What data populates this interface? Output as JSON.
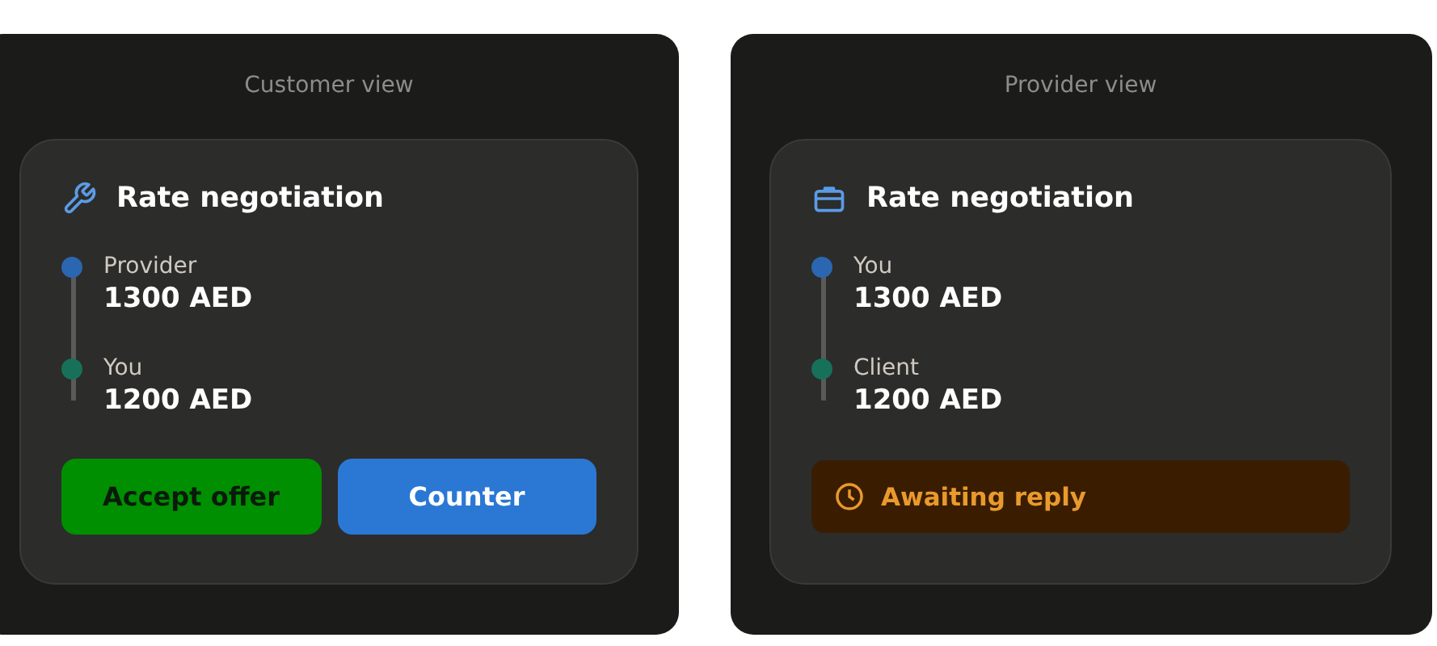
{
  "panels": [
    {
      "title": "Customer view",
      "card": {
        "heading": "Rate negotiation",
        "offers": [
          {
            "party": "Provider",
            "amount": "1300 AED",
            "color": "#2a67b0"
          },
          {
            "party": "You",
            "amount": "1200 AED",
            "color": "#17705a"
          }
        ],
        "footer": {
          "kind": "actions",
          "buttons": [
            {
              "label": "Accept offer",
              "color": "#008f00"
            },
            {
              "label": "Counter",
              "color": "#2b78d4"
            }
          ]
        }
      }
    },
    {
      "title": "Provider view",
      "card": {
        "heading": "Rate negotiation",
        "offers": [
          {
            "party": "You",
            "amount": "1300 AED",
            "color": "#2a67b0"
          },
          {
            "party": "Client",
            "amount": "1200 AED",
            "color": "#17705a"
          }
        ],
        "footer": {
          "kind": "status",
          "label": "Awaiting reply"
        }
      }
    }
  ]
}
